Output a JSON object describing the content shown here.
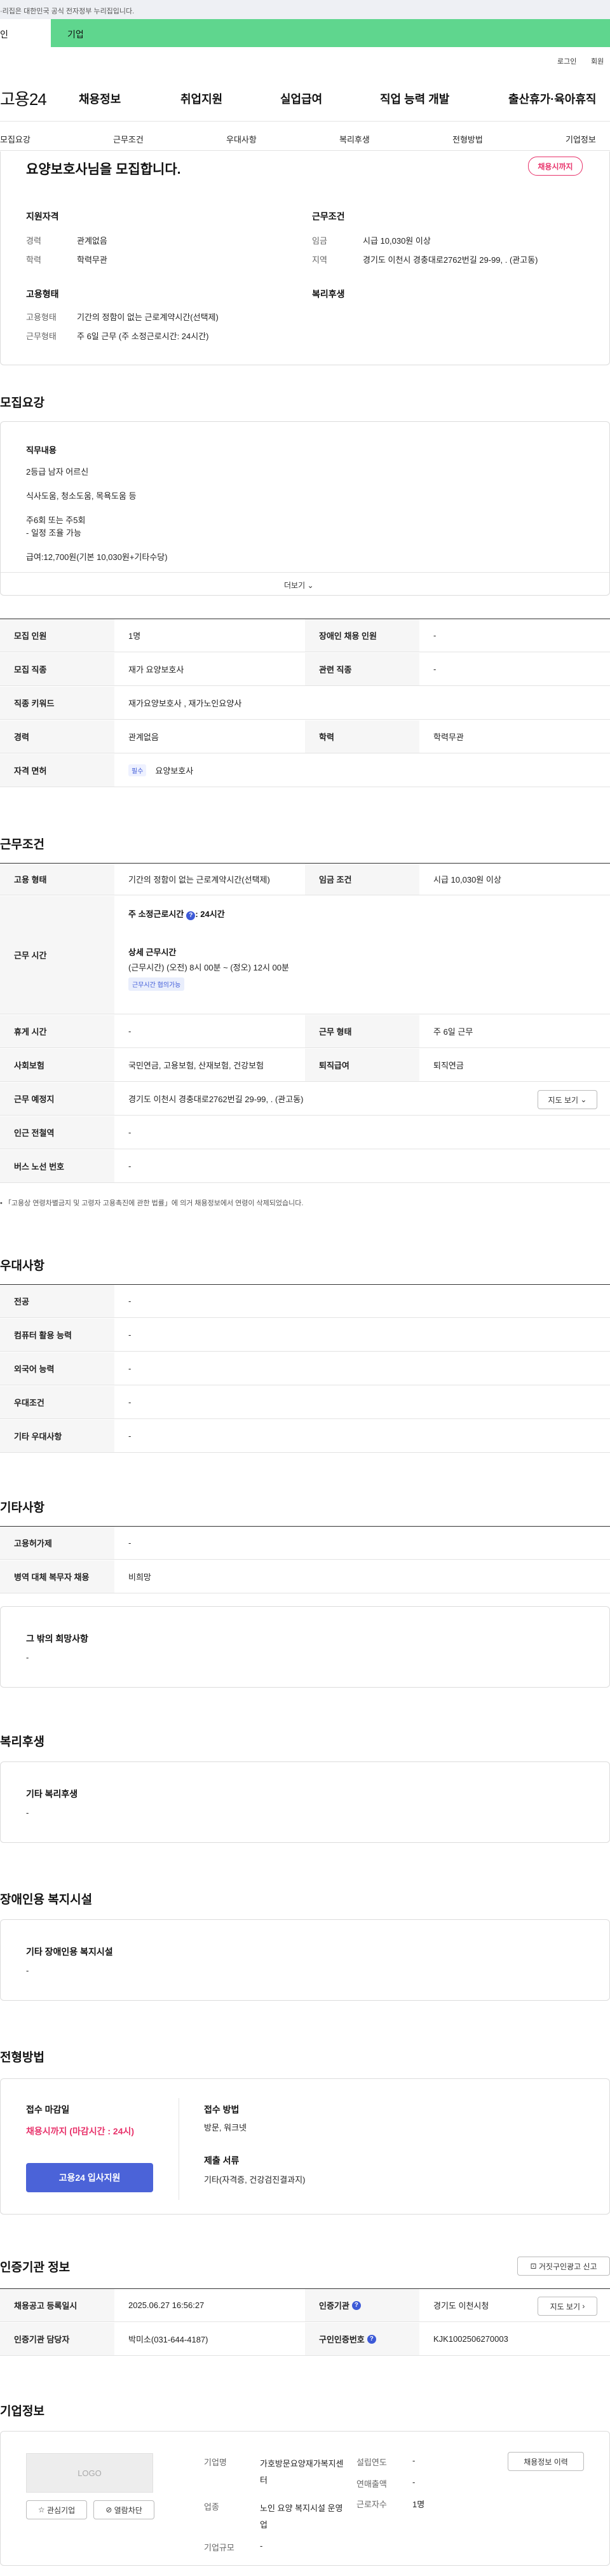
{
  "gov_banner": {
    "text": "·리집은 대한민국 공식 전자정부 누리집입니다."
  },
  "top_tabs": {
    "individual": "인",
    "business": "기업"
  },
  "util": {
    "login": "로그인",
    "signup": "회원"
  },
  "logo": "고용24",
  "gnb": [
    "채용정보",
    "취업지원",
    "실업급여",
    "직업 능력 개발",
    "출산휴가·육아휴직"
  ],
  "snb": [
    "모집요강",
    "근무조건",
    "우대사항",
    "복리후생",
    "전형방법",
    "기업정보"
  ],
  "summary": {
    "title": "요양보호사님을 모집합니다.",
    "status_pill": "채용시까지",
    "qual_heading": "지원자격",
    "career_label": "경력",
    "career_value": "관계없음",
    "edu_label": "학력",
    "edu_value": "학력무관",
    "cond_heading": "근무조건",
    "wage_label": "임금",
    "wage_value": "시급 10,030원 이상",
    "region_label": "지역",
    "region_value": "경기도 이천시 경충대로2762번길 29-99, . (관고동)",
    "emp_heading": "고용형태",
    "emp_type_label": "고용형태",
    "emp_type_value": "기간의 정함이 없는 근로계약시간(선택제)",
    "work_type_label": "근무형태",
    "work_type_value": "주 6일 근무 (주 소정근로시간: 24시간)",
    "welfare_heading": "복리후생"
  },
  "recruit": {
    "heading": "모집요강",
    "duty_heading": "직무내용",
    "duty_lines": [
      "2등급 남자 어르신",
      "식사도움, 청소도움, 목욕도움 등",
      "주6회 또는 주5회",
      "- 일정 조율 가능",
      "급여:12,700원(기본 10,030원+기타수당)"
    ],
    "more_label": "더보기",
    "rows": {
      "headcount_label": "모집 인원",
      "headcount_value": "1명",
      "disabled_label": "장애인 채용 인원",
      "disabled_value": "-",
      "job_label": "모집 직종",
      "job_value": "재가 요양보호사",
      "related_label": "관련 직종",
      "related_value": "-",
      "keyword_label": "직종 키워드",
      "keyword_value": "재가요양보호사 , 재가노인요양사",
      "career_label": "경력",
      "career_value": "관계없음",
      "edu_label": "학력",
      "edu_value": "학력무관",
      "license_label": "자격 면허",
      "license_badge": "필수",
      "license_value": "요양보호사"
    }
  },
  "work": {
    "heading": "근무조건",
    "emp_label": "고용 형태",
    "emp_value": "기간의 정함이 없는 근로계약시간(선택제)",
    "wage_label": "임금 조건",
    "wage_value": "시급 10,030원 이상",
    "hours_label": "근무 시간",
    "hours_main": "주 소정근로시간",
    "hours_main_value": ": 24시간",
    "hours_detail_label": "상세 근무시간",
    "hours_detail_value": "(근무시간) (오전) 8시 00분 ~ (정오) 12시 00분",
    "hours_badge": "근무시간 협의가능",
    "rest_label": "휴게 시간",
    "rest_value": "-",
    "shift_label": "근무 형태",
    "shift_value": "주 6일 근무",
    "insurance_label": "사회보험",
    "insurance_value": "국민연금, 고용보험, 산재보험, 건강보험",
    "retire_label": "퇴직급여",
    "retire_value": "퇴직연금",
    "place_label": "근무 예정지",
    "place_value": "경기도 이천시 경충대로2762번길 29-99, . (관고동)",
    "map_button": "지도 보기",
    "subway_label": "인근 전철역",
    "subway_value": "-",
    "bus_label": "버스 노선 번호",
    "bus_value": "-",
    "notice": "「고용상 연령차별금지 및 고령자 고용촉진에 관한 법률」에 의거 채용정보에서 연령이 삭제되었습니다."
  },
  "prefer": {
    "heading": "우대사항",
    "major_label": "전공",
    "major_value": "-",
    "computer_label": "컴퓨터 활용 능력",
    "computer_value": "-",
    "lang_label": "외국어 능력",
    "lang_value": "-",
    "cond_label": "우대조건",
    "cond_value": "-",
    "etc_label": "기타 우대사항",
    "etc_value": "-"
  },
  "other": {
    "heading": "기타사항",
    "support_label": "고용허가제",
    "support_value": "-",
    "military_label": "병역 대체 복무자 채용",
    "military_value": "비희망",
    "hope_heading": "그 밖의 희망사항",
    "hope_value": "-"
  },
  "welfare": {
    "heading": "복리후생",
    "sub_heading": "기타 복리후생",
    "value": "-"
  },
  "facility": {
    "heading": "장애인용 복지시설",
    "sub_heading": "기타 장애인용 복지시설",
    "value": "-"
  },
  "selection": {
    "heading": "전형방법",
    "deadline_label": "접수 마감일",
    "deadline_value": "채용시까지 (마감시간 : 24시)",
    "apply_button": "고용24 입사지원",
    "method_label": "접수 방법",
    "method_value": "방문, 워크넷",
    "docs_label": "제출 서류",
    "docs_value": "기타(자격증, 건강검진결과지)"
  },
  "certifier": {
    "heading": "인증기관 정보",
    "report_button": "거짓구인광고 신고",
    "reg_label": "채용공고 등록일시",
    "reg_value": "2025.06.27 16:56:27",
    "org_label": "인증기관",
    "org_value": "경기도 이천시청",
    "map_button": "지도 보기",
    "manager_label": "인증기관 담당자",
    "manager_value": "박미소(031-644-4187)",
    "job_no_label": "구인인증번호",
    "job_no_value": "KJK1002506270003"
  },
  "company": {
    "heading": "기업정보",
    "logo_text": "LOGO",
    "interest_button": "관심기업",
    "block_button": "열람차단",
    "name_label": "기업명",
    "name_value": "가호방문요양재가복지센터",
    "industry_label": "업종",
    "industry_value": "노인 요양 복지시설 운영업",
    "scale_label": "기업규모",
    "scale_value": "-",
    "founded_label": "설립연도",
    "founded_value": "-",
    "sales_label": "연매출액",
    "sales_value": "-",
    "employees_label": "근로자수",
    "employees_value": "1명",
    "history_button": "채용정보 이력"
  }
}
